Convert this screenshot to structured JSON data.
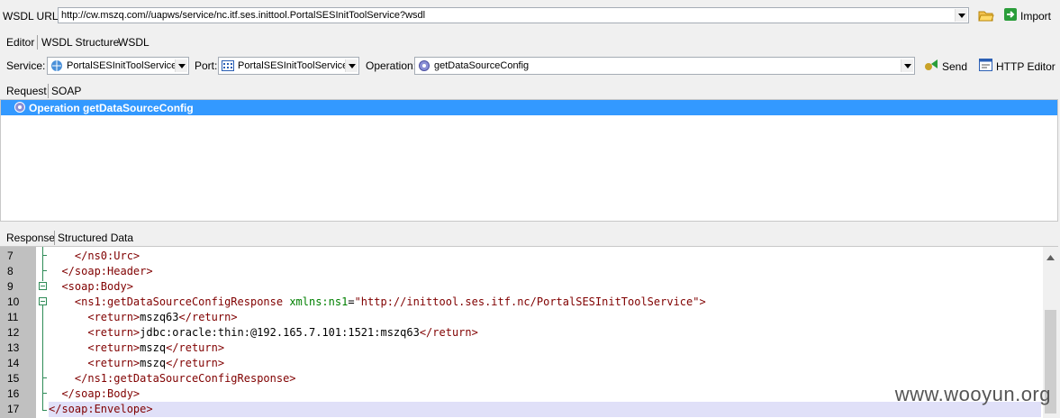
{
  "wsdl": {
    "label": "WSDL URL:",
    "url": "http://cw.mszq.com//uapws/service/nc.itf.ses.inittool.PortalSESInitToolService?wsdl",
    "import_label": "Import"
  },
  "top_tabs": [
    "Editor",
    "WSDL Structure",
    "WSDL"
  ],
  "service_row": {
    "service_label": "Service:",
    "service_value": "PortalSESInitToolService",
    "port_label": "Port:",
    "port_value": "PortalSESInitToolService",
    "operation_label": "Operation:",
    "operation_value": "getDataSourceConfig",
    "send_label": "Send",
    "http_editor_label": "HTTP Editor"
  },
  "request_tabs": [
    "Request",
    "SOAP"
  ],
  "request_tree": {
    "operation_row": "Operation getDataSourceConfig"
  },
  "response_tabs": [
    "Response",
    "Structured Data"
  ],
  "response_lines": [
    {
      "num": "7",
      "text": "    </ns0:Urc>"
    },
    {
      "num": "8",
      "text": "  </soap:Header>"
    },
    {
      "num": "9",
      "text": "  <soap:Body>"
    },
    {
      "num": "10",
      "tag": "    <ns1:getDataSourceConfigResponse ",
      "attr": "xmlns:ns1",
      "eq": "=",
      "str": "\"http://inittool.ses.itf.nc/PortalSESInitToolService\"",
      "close": ">"
    },
    {
      "num": "11",
      "open": "      <return>",
      "val": "mszq63",
      "end": "</return>"
    },
    {
      "num": "12",
      "open": "      <return>",
      "val": "jdbc:oracle:thin:@192.165.7.101:1521:mszq63",
      "end": "</return>"
    },
    {
      "num": "13",
      "open": "      <return>",
      "val": "mszq",
      "end": "</return>"
    },
    {
      "num": "14",
      "open": "      <return>",
      "val": "mszq",
      "end": "</return>"
    },
    {
      "num": "15",
      "text": "    </ns1:getDataSourceConfigResponse>"
    },
    {
      "num": "16",
      "text": "  </soap:Body>"
    },
    {
      "num": "17",
      "text": "</soap:Envelope>"
    }
  ],
  "watermark": "www.wooyun.org",
  "colors": {
    "selection": "#3399ff",
    "tag": "#800000",
    "attr": "#008000"
  }
}
